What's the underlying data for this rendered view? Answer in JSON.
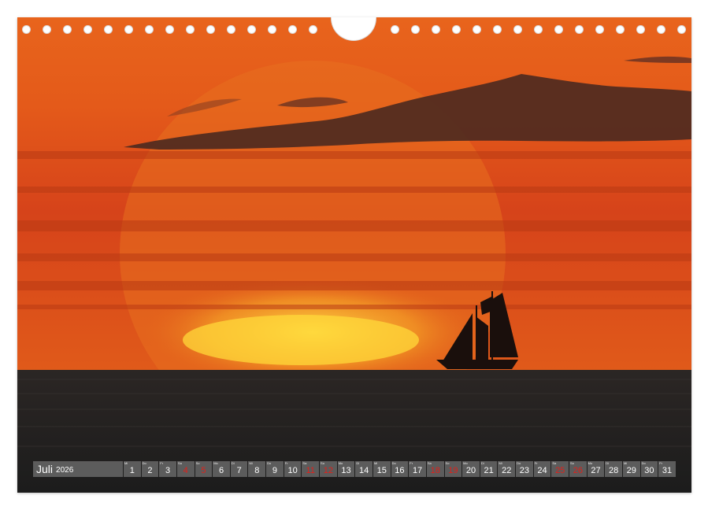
{
  "calendar": {
    "month": "Juli",
    "year": "2026",
    "days": [
      {
        "wd": "Mi",
        "d": "1",
        "weekend": false
      },
      {
        "wd": "Do",
        "d": "2",
        "weekend": false
      },
      {
        "wd": "Fr",
        "d": "3",
        "weekend": false
      },
      {
        "wd": "Sa",
        "d": "4",
        "weekend": true
      },
      {
        "wd": "So",
        "d": "5",
        "weekend": true
      },
      {
        "wd": "Mo",
        "d": "6",
        "weekend": false
      },
      {
        "wd": "Di",
        "d": "7",
        "weekend": false
      },
      {
        "wd": "Mi",
        "d": "8",
        "weekend": false
      },
      {
        "wd": "Do",
        "d": "9",
        "weekend": false
      },
      {
        "wd": "Fr",
        "d": "10",
        "weekend": false
      },
      {
        "wd": "Sa",
        "d": "11",
        "weekend": true
      },
      {
        "wd": "So",
        "d": "12",
        "weekend": true
      },
      {
        "wd": "Mo",
        "d": "13",
        "weekend": false
      },
      {
        "wd": "Di",
        "d": "14",
        "weekend": false
      },
      {
        "wd": "Mi",
        "d": "15",
        "weekend": false
      },
      {
        "wd": "Do",
        "d": "16",
        "weekend": false
      },
      {
        "wd": "Fr",
        "d": "17",
        "weekend": false
      },
      {
        "wd": "Sa",
        "d": "18",
        "weekend": true
      },
      {
        "wd": "So",
        "d": "19",
        "weekend": true
      },
      {
        "wd": "Mo",
        "d": "20",
        "weekend": false
      },
      {
        "wd": "Di",
        "d": "21",
        "weekend": false
      },
      {
        "wd": "Mi",
        "d": "22",
        "weekend": false
      },
      {
        "wd": "Do",
        "d": "23",
        "weekend": false
      },
      {
        "wd": "Fr",
        "d": "24",
        "weekend": false
      },
      {
        "wd": "Sa",
        "d": "25",
        "weekend": true
      },
      {
        "wd": "So",
        "d": "26",
        "weekend": true
      },
      {
        "wd": "Mo",
        "d": "27",
        "weekend": false
      },
      {
        "wd": "Di",
        "d": "28",
        "weekend": false
      },
      {
        "wd": "Mi",
        "d": "29",
        "weekend": false
      },
      {
        "wd": "Do",
        "d": "30",
        "weekend": false
      },
      {
        "wd": "Fr",
        "d": "31",
        "weekend": false
      }
    ]
  },
  "colors": {
    "sky_top": "#e2551a",
    "sky_mid": "#d8461a",
    "sun_glow": "#f6c12a",
    "sea": "#232323",
    "weekend_text": "#e0201a"
  }
}
